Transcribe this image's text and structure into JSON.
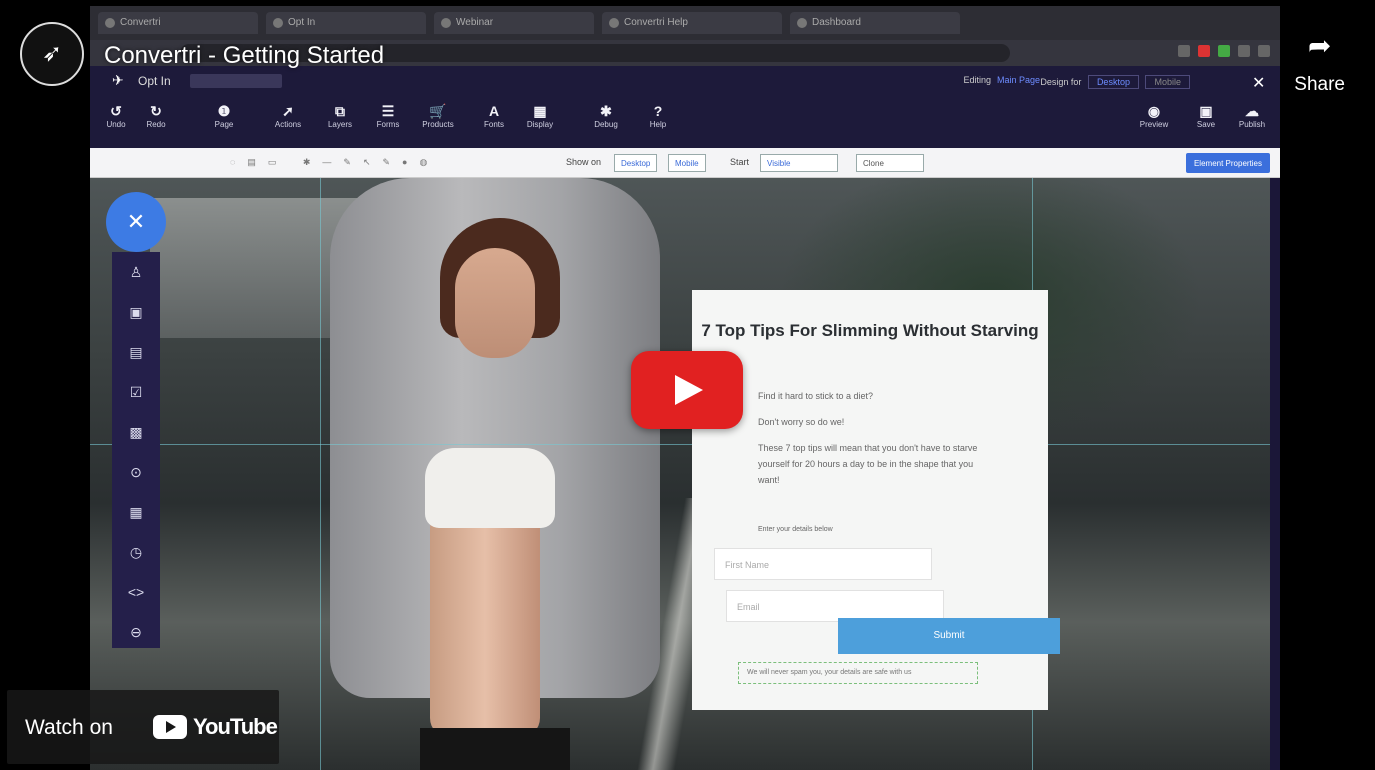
{
  "video": {
    "title": "Convertri - Getting Started",
    "share_label": "Share",
    "watch_on": "Watch on",
    "youtube_brand": "YouTube"
  },
  "browser": {
    "tabs": [
      "Convertri",
      "Opt In",
      "Webinar",
      "Convertri Help",
      "Dashboard"
    ]
  },
  "app": {
    "page_name": "Opt In",
    "editing_label": "Editing",
    "editing_value": "Main Page",
    "design_for_label": "Design for",
    "design_for_options": [
      "Desktop",
      "Mobile"
    ],
    "toolbar_left": [
      {
        "label": "Undo",
        "icon": "undo-icon",
        "glyph": "↺"
      },
      {
        "label": "Redo",
        "icon": "redo-icon",
        "glyph": "↻"
      },
      {
        "label": "Page",
        "icon": "info-icon",
        "glyph": "❶"
      },
      {
        "label": "Actions",
        "icon": "wand-icon",
        "glyph": "➚"
      },
      {
        "label": "Layers",
        "icon": "layers-icon",
        "glyph": "⧉"
      },
      {
        "label": "Forms",
        "icon": "forms-icon",
        "glyph": "☰"
      },
      {
        "label": "Products",
        "icon": "cart-icon",
        "glyph": "🛒"
      },
      {
        "label": "Fonts",
        "icon": "font-icon",
        "glyph": "A"
      },
      {
        "label": "Display",
        "icon": "display-icon",
        "glyph": "▦"
      },
      {
        "label": "Debug",
        "icon": "bug-icon",
        "glyph": "✱"
      },
      {
        "label": "Help",
        "icon": "help-icon",
        "glyph": "?"
      }
    ],
    "toolbar_right": [
      {
        "label": "Preview",
        "icon": "eye-icon",
        "glyph": "◉"
      },
      {
        "label": "Save",
        "icon": "save-icon",
        "glyph": "▣"
      },
      {
        "label": "Publish",
        "icon": "cloud-upload-icon",
        "glyph": "☁"
      }
    ],
    "subbar": {
      "show_on_label": "Show on",
      "show_on_options": [
        "Desktop",
        "Mobile"
      ],
      "start_label": "Start",
      "start_value": "Visible",
      "clone_label": "Clone",
      "element_properties": "Element Properties"
    }
  },
  "optin": {
    "headline": "7 Top Tips For Slimming Without Starving",
    "line1": "Find it hard to stick to a diet?",
    "line2": "Don't worry so do we!",
    "line3": "These 7 top tips will mean that you don't have to starve yourself for 20 hours a day to be in the shape that you want!",
    "form_prompt": "Enter your details below",
    "first_name_placeholder": "First Name",
    "email_placeholder": "Email",
    "submit_label": "Submit",
    "privacy_text": "We will never spam you, your details are safe with us"
  }
}
